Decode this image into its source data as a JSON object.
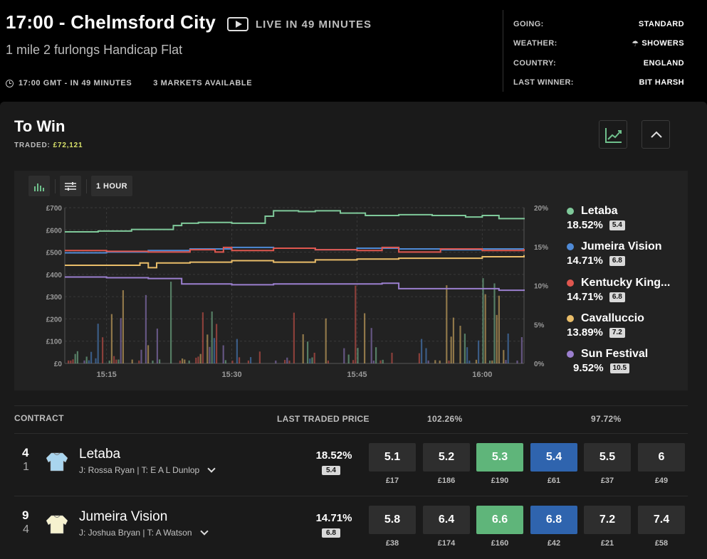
{
  "header": {
    "title": "17:00 - Chelmsford City",
    "live_label": "LIVE IN 49 MINUTES",
    "subtitle": "1 mile 2 furlongs Handicap Flat",
    "time_label": "17:00 GMT - IN 49 MINUTES",
    "markets_label": "3 MARKETS AVAILABLE",
    "info": [
      {
        "key": "GOING:",
        "value": "STANDARD"
      },
      {
        "key": "WEATHER:",
        "value": "SHOWERS",
        "icon": "cloud-rain-icon"
      },
      {
        "key": "COUNTRY:",
        "value": "ENGLAND"
      },
      {
        "key": "LAST WINNER:",
        "value": "BIT HARSH"
      }
    ]
  },
  "market": {
    "title": "To Win",
    "traded_label": "TRADED:",
    "traded_value": "£72,121",
    "accent_color": "#d9e36a"
  },
  "toolbar": {
    "range_label": "1 HOUR"
  },
  "chart_data": {
    "type": "line",
    "y_left_ticks": [
      "£0",
      "£100",
      "£200",
      "£300",
      "£400",
      "£500",
      "£600",
      "£700"
    ],
    "y_left_range": [
      0,
      700
    ],
    "y_right_ticks": [
      "0%",
      "5%",
      "10%",
      "15%",
      "20%"
    ],
    "y_right_range": [
      0,
      20
    ],
    "x_ticks": [
      "15:15",
      "15:30",
      "15:45",
      "16:00"
    ],
    "x_range_minutes": [
      0,
      55
    ],
    "x_tick_minutes": [
      5,
      20,
      35,
      50
    ],
    "grid": true,
    "series": [
      {
        "name": "Letaba",
        "color": "#7fc99a",
        "x": [
          0,
          4,
          8,
          12,
          13,
          14,
          16,
          20,
          24,
          25,
          28,
          30,
          33,
          36,
          40,
          44,
          48,
          50,
          52,
          55
        ],
        "y": [
          16.9,
          17.0,
          17.2,
          17.2,
          17.7,
          18.0,
          18.1,
          18.0,
          18.9,
          19.6,
          19.5,
          19.6,
          19.3,
          19.0,
          19.1,
          19.0,
          18.8,
          19.0,
          18.6,
          18.5
        ]
      },
      {
        "name": "Jumeira Vision",
        "color": "#4f8ad6",
        "x": [
          0,
          5,
          10,
          15,
          20,
          25,
          30,
          35,
          40,
          45,
          50,
          55
        ],
        "y": [
          14.2,
          14.3,
          14.5,
          14.7,
          14.9,
          14.8,
          14.6,
          14.8,
          14.7,
          14.6,
          14.7,
          14.7
        ]
      },
      {
        "name": "Kentucky King...",
        "color": "#e0574f",
        "x": [
          0,
          5,
          10,
          15,
          18,
          19,
          20,
          25,
          30,
          35,
          38,
          40,
          45,
          50,
          55
        ],
        "y": [
          14.5,
          14.4,
          14.3,
          14.6,
          14.3,
          14.9,
          14.5,
          14.8,
          14.6,
          14.5,
          14.9,
          14.3,
          14.7,
          14.5,
          14.7
        ]
      },
      {
        "name": "Cavalluccio",
        "color": "#e9bd69",
        "x": [
          0,
          5,
          9,
          10,
          11,
          15,
          20,
          25,
          30,
          35,
          40,
          45,
          50,
          55
        ],
        "y": [
          12.6,
          12.6,
          12.9,
          12.3,
          12.9,
          13.0,
          13.2,
          13.0,
          13.3,
          13.4,
          13.5,
          13.5,
          13.7,
          13.9
        ]
      },
      {
        "name": "Sun Festival",
        "color": "#9b7fcf",
        "x": [
          0,
          5,
          10,
          14,
          20,
          25,
          30,
          38,
          40,
          45,
          50,
          52,
          55
        ],
        "y": [
          11.1,
          11.0,
          10.9,
          10.2,
          10.1,
          10.2,
          10.2,
          10.3,
          9.6,
          9.6,
          9.6,
          9.4,
          9.5
        ]
      }
    ],
    "legend_placement": "right"
  },
  "legend": [
    {
      "name": "Letaba",
      "pct": "18.52%",
      "odds": "5.4",
      "color": "#7fc99a"
    },
    {
      "name": "Jumeira Vision",
      "pct": "14.71%",
      "odds": "6.8",
      "color": "#4f8ad6"
    },
    {
      "name": "Kentucky King...",
      "pct": "14.71%",
      "odds": "6.8",
      "color": "#e0574f"
    },
    {
      "name": "Cavalluccio",
      "pct": "13.89%",
      "odds": "7.2",
      "color": "#e9bd69"
    },
    {
      "name": "Sun Festival",
      "pct": "9.52%",
      "odds": "10.5",
      "color": "#9b7fcf"
    }
  ],
  "table": {
    "col_contract": "CONTRACT",
    "col_ltp": "LAST TRADED PRICE",
    "col_back_book": "102.26%",
    "col_lay_book": "97.72%",
    "runners": [
      {
        "number": "4",
        "draw": "1",
        "name": "Letaba",
        "jockey_trainer": "J: Rossa Ryan | T: E A L Dunlop",
        "pct": "18.52%",
        "odds": "5.4",
        "silk_color": "#a9d5ef",
        "prices": [
          {
            "price": "5.1",
            "vol": "£17",
            "kind": "back-deep"
          },
          {
            "price": "5.2",
            "vol": "£186",
            "kind": "back-deep"
          },
          {
            "price": "5.3",
            "vol": "£190",
            "kind": "back"
          },
          {
            "price": "5.4",
            "vol": "£61",
            "kind": "lay"
          },
          {
            "price": "5.5",
            "vol": "£37",
            "kind": "lay-deep"
          },
          {
            "price": "6",
            "vol": "£49",
            "kind": "lay-deep"
          }
        ]
      },
      {
        "number": "9",
        "draw": "4",
        "name": "Jumeira Vision",
        "jockey_trainer": "J: Joshua Bryan | T: A Watson",
        "pct": "14.71%",
        "odds": "6.8",
        "silk_color": "#f6f2cf",
        "prices": [
          {
            "price": "5.8",
            "vol": "£38",
            "kind": "back-deep"
          },
          {
            "price": "6.4",
            "vol": "£174",
            "kind": "back-deep"
          },
          {
            "price": "6.6",
            "vol": "£160",
            "kind": "back"
          },
          {
            "price": "6.8",
            "vol": "£42",
            "kind": "lay"
          },
          {
            "price": "7.2",
            "vol": "£21",
            "kind": "lay-deep"
          },
          {
            "price": "7.4",
            "vol": "£58",
            "kind": "lay-deep"
          }
        ]
      }
    ]
  }
}
